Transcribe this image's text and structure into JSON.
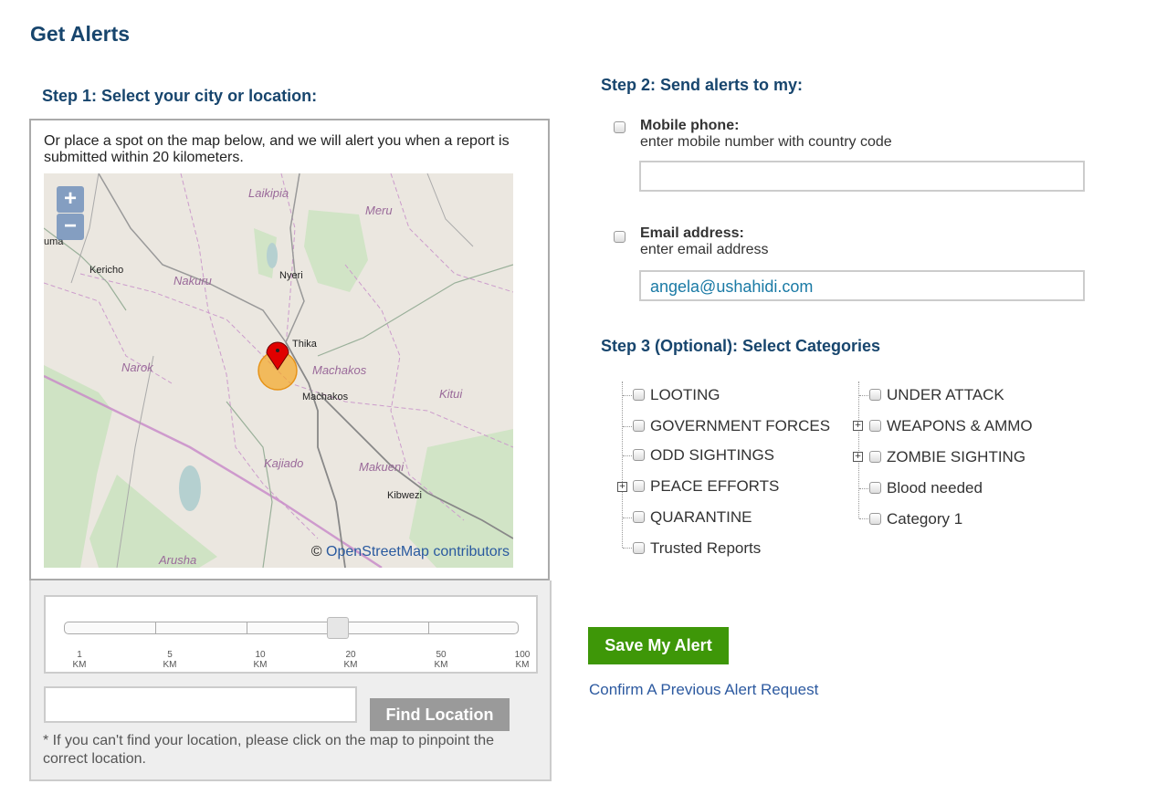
{
  "page": {
    "title": "Get Alerts"
  },
  "step1": {
    "heading": "Step 1: Select your city or location:",
    "description": "Or place a spot on the map below, and we will alert you when a report is submitted within 20 kilometers.",
    "map": {
      "zoom_in": "+",
      "zoom_out": "−",
      "attribution_prefix": "©",
      "attribution_link": "OpenStreetMap contributors",
      "place_labels": {
        "laikipia": "Laikipia",
        "meru": "Meru",
        "kericho": "Kericho",
        "nakuru": "Nakuru",
        "nyeri": "Nyeri",
        "thika": "Thika",
        "narok": "Narok",
        "machakos_region": "Machakos",
        "machakos_town": "Machakos",
        "kitui": "Kitui",
        "kajiado": "Kajiado",
        "makueni": "Makueni",
        "kibwezi": "Kibwezi",
        "arusha": "Arusha",
        "bumala": "uma"
      }
    },
    "radius_slider": {
      "selected_km": 20,
      "ticks": [
        {
          "value": "1",
          "unit": "KM"
        },
        {
          "value": "5",
          "unit": "KM"
        },
        {
          "value": "10",
          "unit": "KM"
        },
        {
          "value": "20",
          "unit": "KM"
        },
        {
          "value": "50",
          "unit": "KM"
        },
        {
          "value": "100",
          "unit": "KM"
        }
      ]
    },
    "location_input": {
      "value": "",
      "placeholder": ""
    },
    "find_button": "Find Location",
    "note": "* If you can't find your location, please click on the map to pinpoint the correct location."
  },
  "step2": {
    "heading": "Step 2: Send alerts to my:",
    "mobile": {
      "label": "Mobile phone:",
      "hint": "enter mobile number with country code",
      "value": "",
      "checked": false
    },
    "email": {
      "label": "Email address:",
      "hint": "enter email address",
      "value": "angela@ushahidi.com",
      "checked": false
    }
  },
  "step3": {
    "heading": "Step 3 (Optional): Select Categories",
    "left_categories": [
      "LOOTING",
      "GOVERNMENT FORCES",
      "ODD SIGHTINGS",
      "PEACE EFFORTS",
      "QUARANTINE",
      "Trusted Reports"
    ],
    "right_categories": [
      "UNDER ATTACK",
      "WEAPONS & AMMO",
      "ZOMBIE SIGHTING",
      "Blood needed",
      "Category 1"
    ]
  },
  "actions": {
    "save_button": "Save My Alert",
    "confirm_link": "Confirm A Previous Alert Request"
  },
  "colors": {
    "heading": "#17456d",
    "save_button": "#3e9708",
    "link": "#2d5aa0",
    "marker": "#e00000",
    "radius_circle": "#f5a623"
  }
}
